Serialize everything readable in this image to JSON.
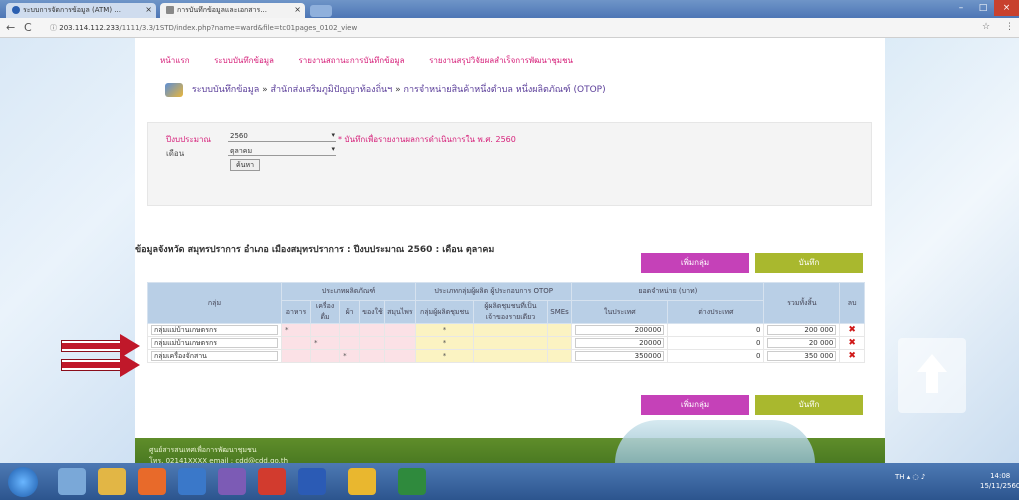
{
  "browser": {
    "tabs": [
      {
        "label": "ระบบการจัดการข้อมูล (ATM) ..."
      },
      {
        "label": "การบันทึกข้อมูลและเอกสาร..."
      }
    ],
    "url_host": "203.114.112.233",
    "url_path": "/1111/3.3/1STD/index.php?name=ward&file=tc01pages_0102_view"
  },
  "menu": [
    "หน้าแรก",
    "ระบบบันทึกข้อมูล",
    "รายงานสถานะการบันทึกข้อมูล",
    "รายงานสรุปวิจัยผลสำเร็จการพัฒนาชุมชน"
  ],
  "breadcrumb": {
    "part1": "ระบบบันทึกข้อมูล",
    "sep": "»",
    "part2": "สำนักส่งเสริมภูมิปัญญาท้องถิ่นฯ",
    "part3": "การจำหน่ายสินค้าหนึ่งตำบล หนึ่งผลิตภัณฑ์ (OTOP)"
  },
  "filter": {
    "year_label": "ปีงบประมาณ",
    "year_value": "2560",
    "month_label": "เดือน",
    "month_value": "ตุลาคม",
    "search_button": "ค้นหา",
    "note": "* บันทึกเพื่อรายงานผลการดำเนินการใน พ.ศ. 2560"
  },
  "info_line": "ข้อมูลจังหวัด สมุทรปราการ อำเภอ เมืองสมุทรปราการ : ปีงบประมาณ 2560 : เดือน ตุลาคม",
  "buttons": {
    "add_row": "เพิ่มกลุ่ม",
    "save": "บันทึก"
  },
  "table": {
    "h_group": "กลุ่ม",
    "h_cat": "ประเภทผลิตภัณฑ์",
    "h_type": "ประเภทกลุ่มผู้ผลิต ผู้ประกอบการ OTOP",
    "h_sales": "ยอดจำหน่าย (บาท)",
    "h_total": "รวมทั้งสิ้น",
    "h_del": "ลบ",
    "sub_cat": [
      "อาหาร",
      "เครื่องดื่ม",
      "ผ้า",
      "ของใช้",
      "สมุนไพร"
    ],
    "sub_type": [
      "กลุ่มผู้ผลิตชุมชน",
      "ผู้ผลิตชุมชนที่เป็นเจ้าของรายเดียว",
      "SMEs"
    ],
    "sub_sales": [
      "ในประเทศ",
      "ต่างประเทศ"
    ],
    "rows": [
      {
        "name": "กลุ่มแม่บ้านเกษตรกร",
        "cat": [
          "*",
          "",
          "",
          "",
          ""
        ],
        "type": [
          "*",
          "",
          ""
        ],
        "dom": "200000",
        "intl": "0",
        "total": "200 000"
      },
      {
        "name": "กลุ่มแม่บ้านเกษตรกร",
        "cat": [
          "",
          "*",
          "",
          "",
          ""
        ],
        "type": [
          "*",
          "",
          ""
        ],
        "dom": "20000",
        "intl": "0",
        "total": "20 000"
      },
      {
        "name": "กลุ่มเครื่องจักสาน",
        "cat": [
          "",
          "",
          "*",
          "",
          ""
        ],
        "type": [
          "*",
          "",
          ""
        ],
        "dom": "350000",
        "intl": "0",
        "total": "350 000"
      }
    ]
  },
  "footer": {
    "line1": "ศูนย์สารสนเทศเพื่อการพัฒนาชุมชน",
    "line2": "โทร. 02141XXXX email : cdd@cdd.go.th"
  },
  "taskbar": {
    "time": "14:08",
    "date": "15/11/2560",
    "lang": "TH"
  },
  "colors": {
    "accent": "#d6207a",
    "purple_button": "#c541b8",
    "olive_button": "#a9b82e",
    "header_blue": "#b9cfe6",
    "footer_green": "#5f8d2a",
    "arrow_red": "#c0182a"
  }
}
